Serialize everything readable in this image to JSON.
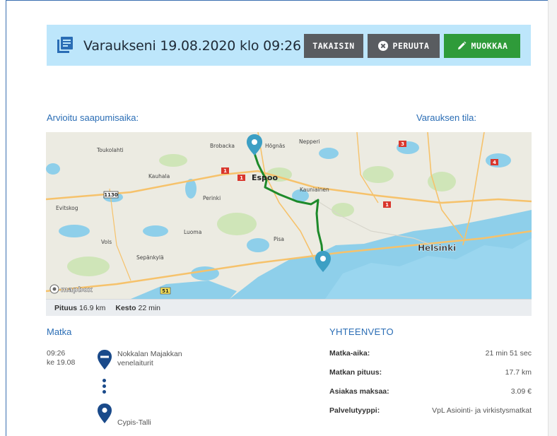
{
  "header": {
    "title": "Varaukseni 19.08.2020 klo 09:26",
    "back_label": "TAKAISIN",
    "cancel_label": "PERUUTA",
    "edit_label": "MUOKKAA"
  },
  "labels": {
    "arrival": "Arvioitu saapumisaika:",
    "status": "Varauksen tila:"
  },
  "map": {
    "places": [
      "Toukolahti",
      "Brobacka",
      "Högnäs",
      "Nepperi",
      "Kauhala",
      "Espoo",
      "Kauniainen",
      "Perinki",
      "Evitskog",
      "Luoma",
      "Vols",
      "Pisa",
      "Sepänkylä",
      "Helsinki"
    ],
    "road_numbers": [
      "1130",
      "1",
      "1",
      "1",
      "3",
      "4",
      "51"
    ],
    "attribution": "mapbox",
    "route_color": "#1d8a2a"
  },
  "route_info": {
    "length_label": "Pituus",
    "length_value": "16.9 km",
    "duration_label": "Kesto",
    "duration_value": "22 min"
  },
  "trip": {
    "section_title": "Matka",
    "time": "09:26",
    "date": "ke 19.08",
    "start_line1": "Nokkalan Majakkan",
    "start_line2": "venelaiturit",
    "end": "Cypis-Talli"
  },
  "summary": {
    "section_title": "YHTEENVETO",
    "rows": [
      {
        "key": "Matka-aika:",
        "value": "21 min 51 sec"
      },
      {
        "key": "Matkan pituus:",
        "value": "17.7 km"
      },
      {
        "key": "Asiakas maksaa:",
        "value": "3.09 €"
      },
      {
        "key": "Palvelutyyppi:",
        "value": "VpL Asiointi- ja virkistysmatkat"
      }
    ]
  },
  "colors": {
    "header_bg": "#bde6fb",
    "accent": "#2a6db5",
    "button_gray": "#595c60",
    "button_green": "#2f9b3a"
  }
}
